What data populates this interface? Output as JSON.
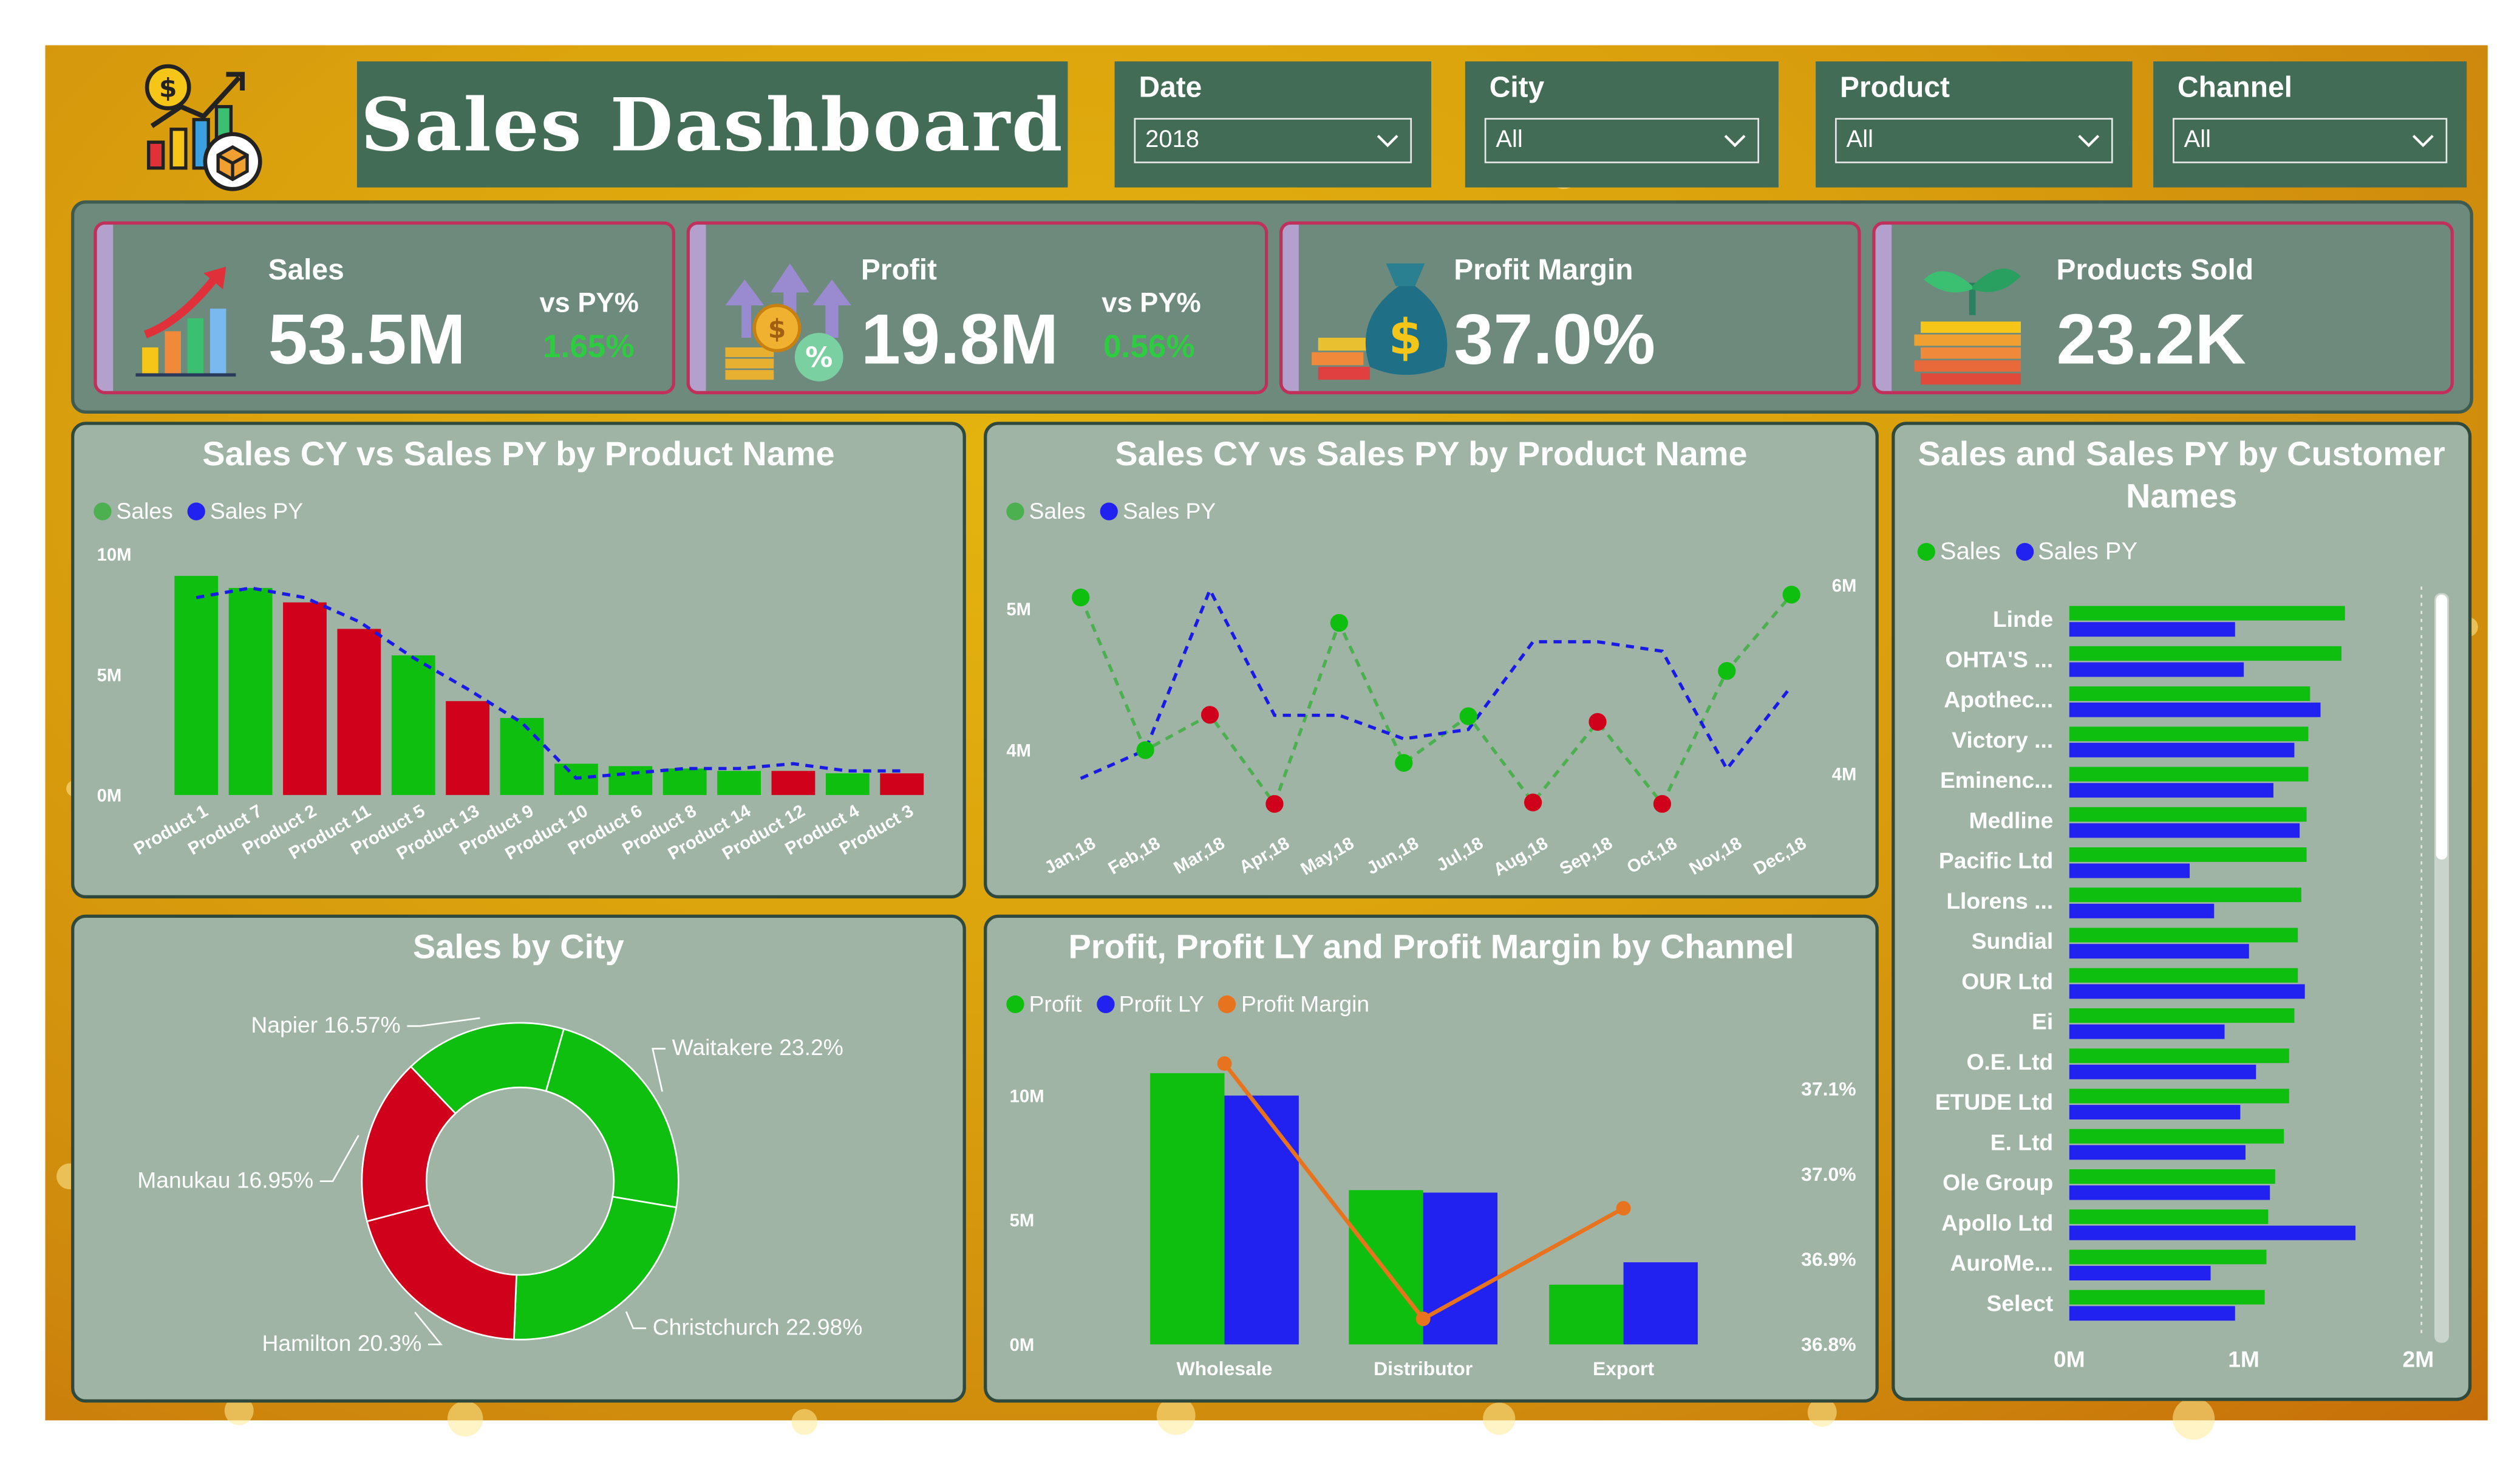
{
  "header": {
    "title": "Sales Dashboard",
    "logo_icon": "sales-growth-icon"
  },
  "slicers": [
    {
      "label": "Date",
      "value": "2018"
    },
    {
      "label": "City",
      "value": "All"
    },
    {
      "label": "Product",
      "value": "All"
    },
    {
      "label": "Channel",
      "value": "All"
    }
  ],
  "kpis": [
    {
      "title": "Sales",
      "value": "53.5M",
      "vs_label": "vs PY%",
      "vs_value": "1.65%",
      "icon": "sales-growth-icon"
    },
    {
      "title": "Profit",
      "value": "19.8M",
      "vs_label": "vs PY%",
      "vs_value": "0.56%",
      "icon": "profit-coins-icon"
    },
    {
      "title": "Profit Margin",
      "value": "37.0%",
      "icon": "money-bag-icon"
    },
    {
      "title": "Products Sold",
      "value": "23.2K",
      "icon": "plant-coins-icon"
    }
  ],
  "colors": {
    "green": "#0fbf0f",
    "red": "#d0021b",
    "blue": "#2222f0",
    "orange": "#e8731e",
    "panel": "#9fb4a5",
    "header": "#436c57"
  },
  "chart_data": [
    {
      "type": "bar",
      "title": "Sales CY vs Sales PY by Product Name",
      "legend": [
        "Sales",
        "Sales PY"
      ],
      "categories": [
        "Product 1",
        "Product 7",
        "Product 2",
        "Product 11",
        "Product 5",
        "Product 13",
        "Product 9",
        "Product 10",
        "Product 6",
        "Product 8",
        "Product 14",
        "Product 12",
        "Product 4",
        "Product 3"
      ],
      "series": [
        {
          "name": "Sales",
          "values": [
            9.1,
            8.6,
            8.0,
            6.9,
            5.8,
            3.9,
            3.2,
            1.3,
            1.2,
            1.1,
            1.0,
            1.0,
            0.9,
            0.9
          ]
        },
        {
          "name": "Sales PY",
          "values": [
            8.2,
            8.6,
            8.2,
            7.2,
            5.7,
            4.4,
            3.0,
            0.7,
            0.9,
            1.1,
            1.1,
            1.3,
            1.0,
            1.0
          ]
        }
      ],
      "bar_status": [
        "up",
        "up",
        "down",
        "down",
        "up",
        "down",
        "up",
        "up",
        "up",
        "up",
        "up",
        "down",
        "up",
        "down"
      ],
      "yticks": [
        "0M",
        "5M",
        "10M"
      ],
      "ylim": [
        0,
        10
      ]
    },
    {
      "type": "line",
      "title": "Sales CY vs Sales PY by Product Name",
      "legend": [
        "Sales",
        "Sales PY"
      ],
      "x": [
        "Jan,18",
        "Feb,18",
        "Mar,18",
        "Apr,18",
        "May,18",
        "Jun,18",
        "Jul,18",
        "Aug,18",
        "Sep,18",
        "Oct,18",
        "Nov,18",
        "Dec,18"
      ],
      "series": [
        {
          "name": "Sales",
          "values": [
            5.08,
            4.0,
            4.25,
            3.62,
            4.9,
            3.91,
            4.24,
            3.63,
            4.2,
            3.62,
            4.56,
            5.1
          ]
        },
        {
          "name": "Sales PY",
          "values": [
            3.95,
            4.25,
            5.95,
            4.62,
            4.62,
            4.37,
            4.47,
            5.4,
            5.4,
            5.3,
            4.05,
            4.93
          ]
        }
      ],
      "point_status": [
        "up",
        "up",
        "down",
        "down",
        "up",
        "up",
        "up",
        "down",
        "down",
        "down",
        "up",
        "up"
      ],
      "yticks_left": [
        "4M",
        "5M"
      ],
      "yticks_right": [
        "4M",
        "6M"
      ],
      "ylim_left": [
        3.5,
        5.5
      ],
      "ylim_right": [
        3.5,
        6.5
      ]
    },
    {
      "type": "bar",
      "orientation": "horizontal",
      "title": "Sales and Sales PY by Customer Names",
      "legend": [
        "Sales",
        "Sales PY"
      ],
      "categories": [
        "Linde",
        "OHTA'S ...",
        "Apothec...",
        "Victory ...",
        "Eminenc...",
        "Medline",
        "Pacific Ltd",
        "Llorens ...",
        "Sundial",
        "OUR Ltd",
        "Ei",
        "O.E. Ltd",
        "ETUDE Ltd",
        "E. Ltd",
        "Ole Group",
        "Apollo Ltd",
        "AuroMe...",
        "Select"
      ],
      "series": [
        {
          "name": "Sales",
          "values": [
            1.58,
            1.56,
            1.38,
            1.37,
            1.37,
            1.36,
            1.36,
            1.33,
            1.31,
            1.31,
            1.29,
            1.26,
            1.26,
            1.23,
            1.18,
            1.14,
            1.13,
            1.12
          ]
        },
        {
          "name": "Sales PY",
          "values": [
            0.95,
            1.0,
            1.44,
            1.29,
            1.17,
            1.32,
            0.69,
            0.83,
            1.03,
            1.35,
            0.89,
            1.07,
            0.98,
            1.01,
            1.15,
            1.64,
            0.81,
            0.95
          ]
        }
      ],
      "xticks": [
        "0M",
        "1M",
        "2M"
      ],
      "xlim": [
        0,
        2
      ]
    },
    {
      "type": "pie",
      "title": "Sales by City",
      "labels": [
        "Waitakere",
        "Christchurch",
        "Hamilton",
        "Manukau",
        "Napier"
      ],
      "values": [
        23.2,
        22.98,
        20.3,
        16.95,
        16.57
      ],
      "label_text": [
        "Waitakere 23.2%",
        "Christchurch 22.98%",
        "Hamilton 20.3%",
        "Manukau 16.95%",
        "Napier 16.57%"
      ],
      "status": [
        "up",
        "up",
        "down",
        "down",
        "up"
      ]
    },
    {
      "type": "bar",
      "title": "Profit, Profit LY and Profit Margin by Channel",
      "legend": [
        "Profit",
        "Profit LY",
        "Profit Margin"
      ],
      "categories": [
        "Wholesale",
        "Distributor",
        "Export"
      ],
      "series": [
        {
          "name": "Profit",
          "values": [
            10.9,
            6.2,
            2.4
          ]
        },
        {
          "name": "Profit LY",
          "values": [
            10.0,
            6.1,
            3.3
          ]
        },
        {
          "name": "Profit Margin",
          "values": [
            37.13,
            36.83,
            36.96
          ]
        }
      ],
      "yticks_left": [
        "0M",
        "5M",
        "10M"
      ],
      "yticks_right": [
        "36.8%",
        "36.9%",
        "37.0%",
        "37.1%"
      ],
      "ylim_left": [
        0,
        10
      ],
      "ylim_right": [
        36.8,
        37.1
      ]
    }
  ]
}
